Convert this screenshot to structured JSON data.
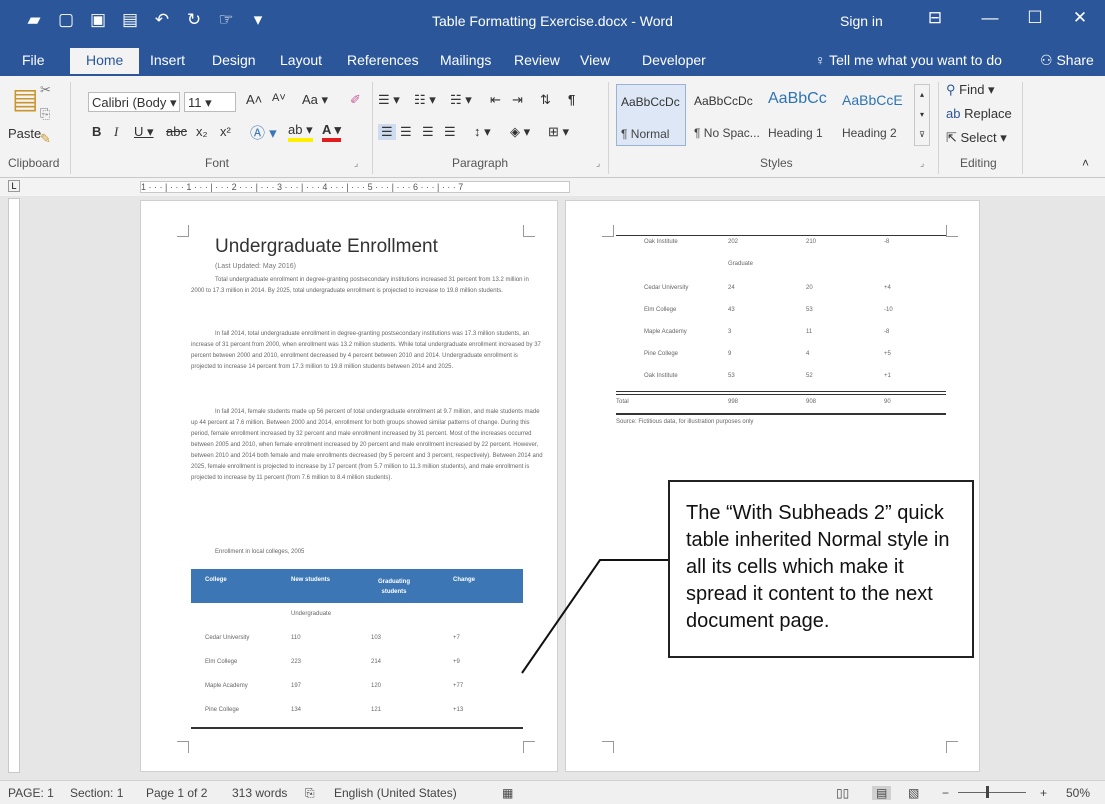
{
  "titlebar": {
    "title": "Table Formatting Exercise.docx - Word",
    "sign_in": "Sign in",
    "qat_icons": [
      "folder-icon",
      "new-doc-icon",
      "save-icon",
      "print-preview-icon",
      "undo-icon",
      "redo-icon",
      "touch-mode-icon",
      "customize-icon"
    ]
  },
  "tabs": [
    "File",
    "Home",
    "Insert",
    "Design",
    "Layout",
    "References",
    "Mailings",
    "Review",
    "View",
    "Developer"
  ],
  "tell_me": "Tell me what you want to do",
  "share": "Share",
  "ribbon": {
    "clipboard": {
      "paste": "Paste",
      "label": "Clipboard"
    },
    "font": {
      "name": "Calibri (Body",
      "size": "11",
      "label": "Font",
      "aa": "Aa"
    },
    "paragraph": {
      "label": "Paragraph"
    },
    "styles": {
      "label": "Styles",
      "items": [
        {
          "preview": "AaBbCcDc",
          "name": "¶ Normal"
        },
        {
          "preview": "AaBbCcDc",
          "name": "¶ No Spac..."
        },
        {
          "preview": "AaBbCc",
          "name": "Heading 1"
        },
        {
          "preview": "AaBbCcE",
          "name": "Heading 2"
        }
      ]
    },
    "editing": {
      "find": "Find",
      "replace": "Replace",
      "select": "Select",
      "label": "Editing"
    }
  },
  "page1": {
    "heading": "Undergraduate Enrollment",
    "last_updated": "(Last Updated: May 2016)",
    "paragraphs": [
      "Total undergraduate enrollment in degree-granting postsecondary institutions increased 31 percent from 13.2 million in 2000 to 17.3 million in 2014. By 2025, total undergraduate enrollment is projected to increase to 19.8 million students.",
      "In fall 2014, total undergraduate enrollment in degree-granting postsecondary institutions was 17.3 million students, an increase of 31 percent from 2000, when enrollment was 13.2 million students. While total undergraduate enrollment increased by 37 percent between 2000 and 2010, enrollment decreased by 4 percent between 2010 and 2014. Undergraduate enrollment is projected to increase 14 percent from 17.3 million to 19.8 million students between 2014 and 2025.",
      "In fall 2014, female students made up 56 percent of total undergraduate enrollment at 9.7 million, and male students made up 44 percent at 7.6 million. Between 2000 and 2014, enrollment for both groups showed similar patterns of change. During this period, female enrollment increased by 32 percent and male enrollment increased by 31 percent. Most of the increases occurred between 2005 and 2010, when female enrollment increased by 20 percent and male enrollment increased by 22 percent. However, between 2010 and 2014 both female and male enrollments decreased (by 5 percent and 3 percent, respectively). Between 2014 and 2025, female enrollment is projected to increase by 17 percent (from 5.7 million to 11.3 million students), and male enrollment is projected to increase by 11 percent (from 7.6 million to 8.4 million students)."
    ],
    "caption": "Enrollment in local colleges, 2005",
    "table_headers": [
      "College",
      "New students",
      "Graduating students",
      "Change"
    ],
    "subhead": "Undergraduate",
    "rows": [
      [
        "Cedar University",
        "110",
        "103",
        "+7"
      ],
      [
        "Elm College",
        "223",
        "214",
        "+9"
      ],
      [
        "Maple Academy",
        "197",
        "120",
        "+77"
      ],
      [
        "Pine College",
        "134",
        "121",
        "+13"
      ]
    ]
  },
  "page2": {
    "rows_top": [
      [
        "Oak Institute",
        "202",
        "210",
        "-8"
      ]
    ],
    "subhead": "Graduate",
    "rows": [
      [
        "Cedar University",
        "24",
        "20",
        "+4"
      ],
      [
        "Elm College",
        "43",
        "53",
        "-10"
      ],
      [
        "Maple Academy",
        "3",
        "11",
        "-8"
      ],
      [
        "Pine College",
        "9",
        "4",
        "+5"
      ],
      [
        "Oak Institute",
        "53",
        "52",
        "+1"
      ]
    ],
    "total": [
      "Total",
      "998",
      "908",
      "90"
    ],
    "source": "Source: Fictitious data, for illustration purposes only"
  },
  "callout": "The “With Subheads 2” quick table inherited Normal style in all its cells which make it spread it content to the next document page.",
  "status": {
    "page": "PAGE: 1",
    "section": "Section: 1",
    "pages": "Page 1 of 2",
    "words": "313 words",
    "language": "English (United States)",
    "zoom": "50%"
  },
  "colors": {
    "accent": "#2b579a",
    "table_header": "#3c76b5"
  }
}
